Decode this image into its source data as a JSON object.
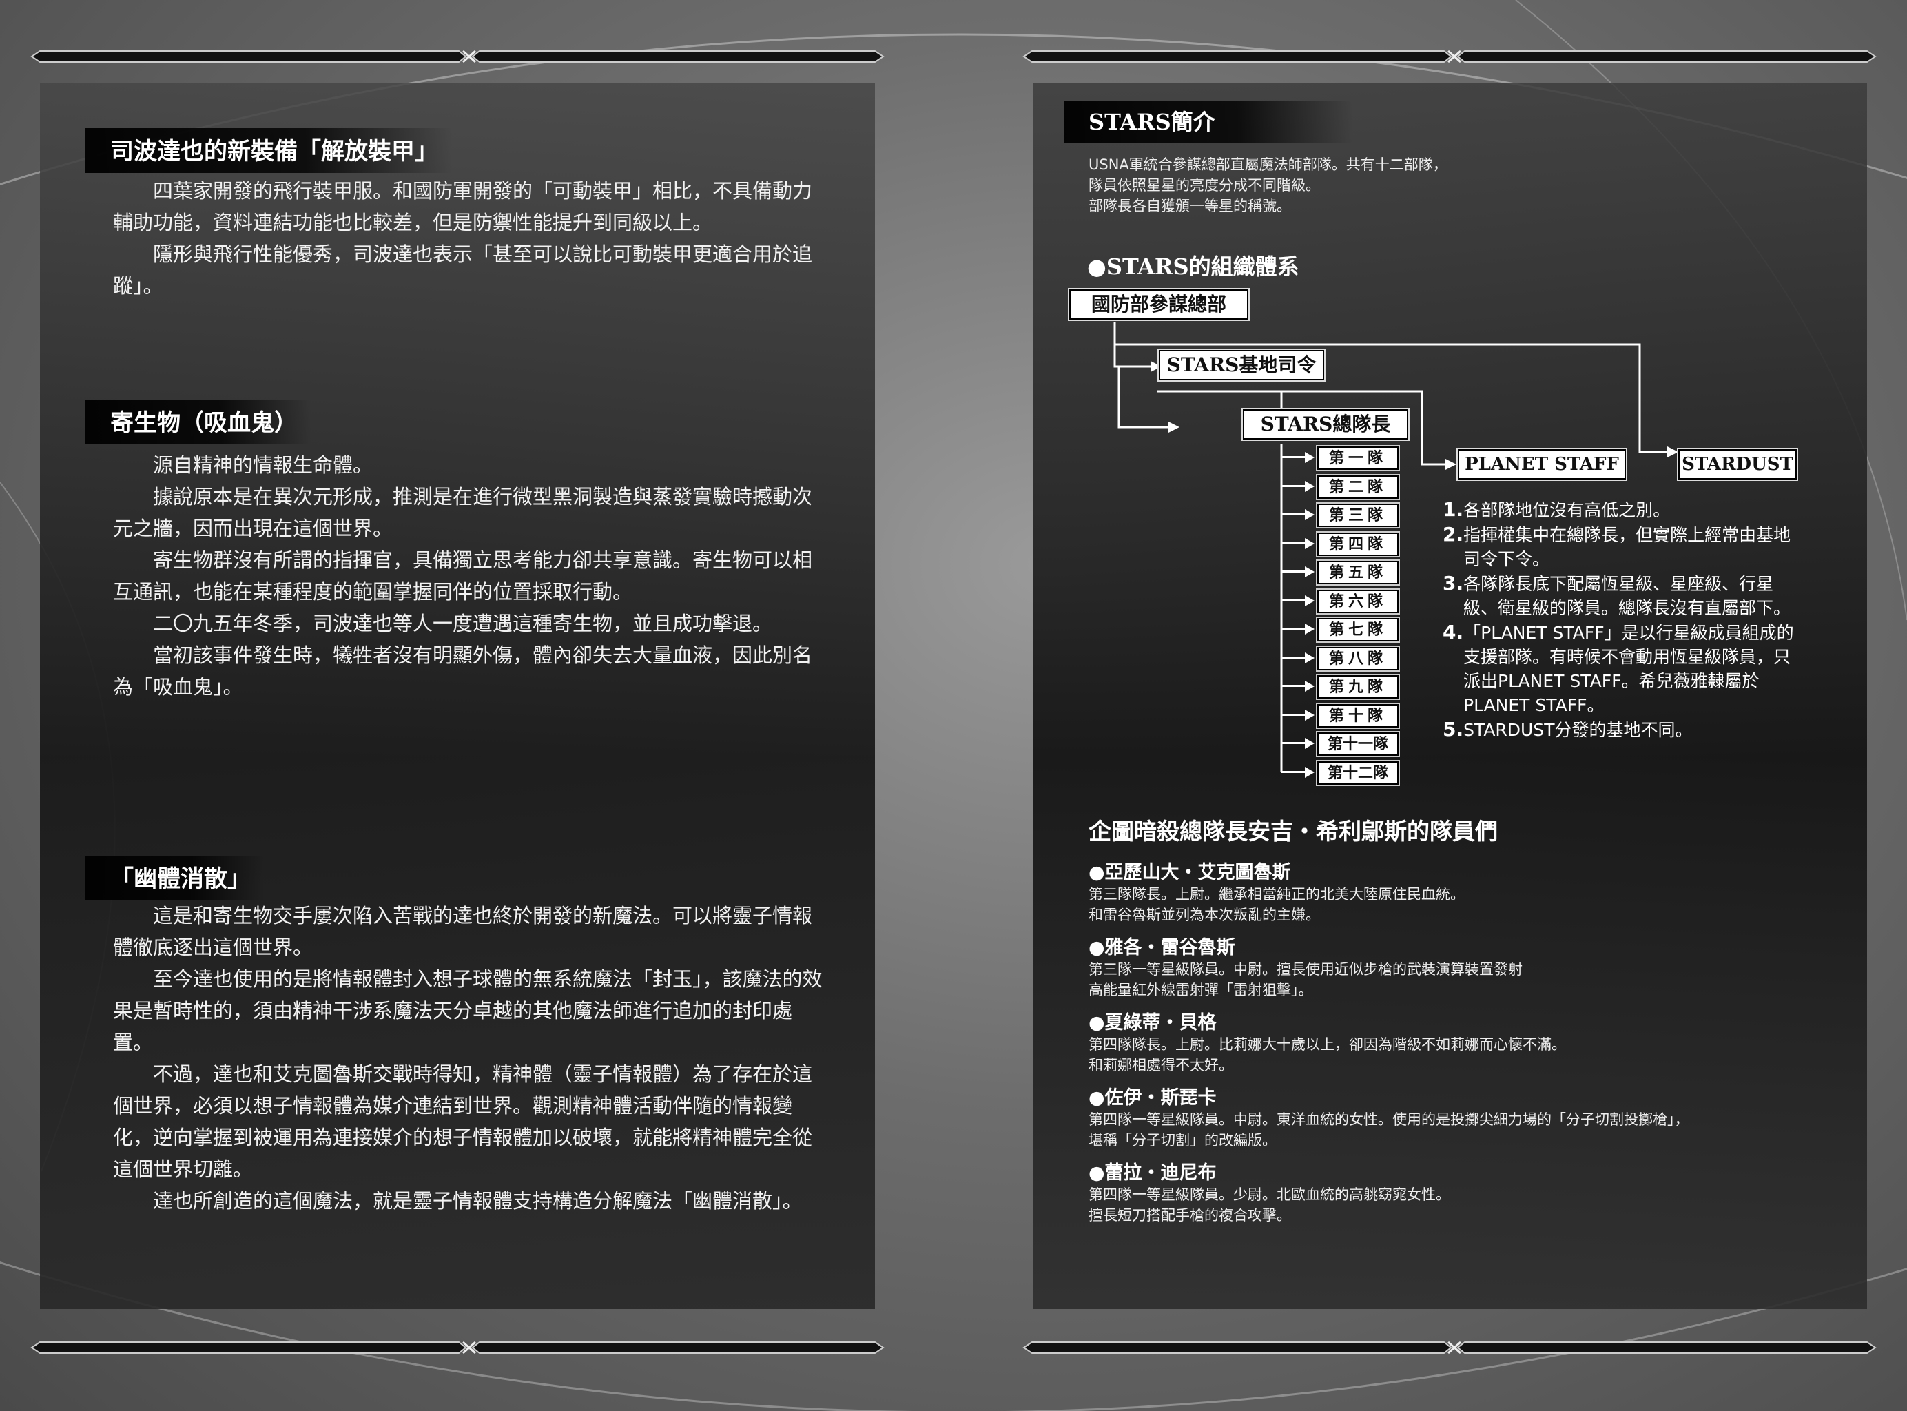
{
  "left": {
    "sections": [
      {
        "title": "司波達也的新裝備「解放裝甲」",
        "paragraphs": [
          "四葉家開發的飛行裝甲服。和國防軍開發的「可動裝甲」相比，不具備動力輔助功能，資料連結功能也比較差，但是防禦性能提升到同級以上。",
          "隱形與飛行性能優秀，司波達也表示「甚至可以說比可動裝甲更適合用於追蹤」。"
        ]
      },
      {
        "title": "寄生物（吸血鬼）",
        "paragraphs": [
          "源自精神的情報生命體。",
          "據說原本是在異次元形成，推測是在進行微型黑洞製造與蒸發實驗時撼動次元之牆，因而出現在這個世界。",
          "寄生物群沒有所謂的指揮官，具備獨立思考能力卻共享意識。寄生物可以相互通訊，也能在某種程度的範圍掌握同伴的位置採取行動。",
          "二〇九五年冬季，司波達也等人一度遭遇這種寄生物，並且成功擊退。",
          "當初該事件發生時，犧牲者沒有明顯外傷，體內卻失去大量血液，因此別名為「吸血鬼」。"
        ]
      },
      {
        "title": "「幽體消散」",
        "paragraphs": [
          "這是和寄生物交手屢次陷入苦戰的達也終於開發的新魔法。可以將靈子情報體徹底逐出這個世界。",
          "至今達也使用的是將情報體封入想子球體的無系統魔法「封玉」，該魔法的效果是暫時性的，須由精神干涉系魔法天分卓越的其他魔法師進行追加的封印處置。",
          "不過，達也和艾克圖魯斯交戰時得知，精神體（靈子情報體）為了存在於這個世界，必須以想子情報體為媒介連結到世界。觀測精神體活動伴隨的情報變化，逆向掌握到被運用為連接媒介的想子情報體加以破壞，就能將精神體完全從這個世界切離。",
          "達也所創造的這個魔法，就是靈子情報體支持構造分解魔法「幽體消散」。"
        ]
      }
    ]
  },
  "right": {
    "stars_intro": {
      "title": "STARS簡介",
      "lines": [
        "USNA軍統合參謀總部直屬魔法師部隊。共有十二部隊，",
        "隊員依照星星的亮度分成不同階級。",
        "部隊長各自獲頒一等星的稱號。"
      ]
    },
    "org_chart": {
      "title": "●STARS的組織體系",
      "hq": "國防部參謀總部",
      "base_commander": "STARS基地司令",
      "commander": "STARS總隊長",
      "planet_staff": "PLANET STAFF",
      "stardust": "STARDUST",
      "squads": [
        "第一隊",
        "第二隊",
        "第三隊",
        "第四隊",
        "第五隊",
        "第六隊",
        "第七隊",
        "第八隊",
        "第九隊",
        "第十隊",
        "第十一隊",
        "第十二隊"
      ]
    },
    "notes": [
      {
        "num": "1.",
        "text": "各部隊地位沒有高低之別。"
      },
      {
        "num": "2.",
        "text": "指揮權集中在總隊長，但實際上經常由基地司令下令。"
      },
      {
        "num": "3.",
        "text": "各隊隊長底下配屬恆星級、星座級、行星級、衛星級的隊員。總隊長沒有直屬部下。"
      },
      {
        "num": "4.",
        "text": "「PLANET STAFF」是以行星級成員組成的支援部隊。有時候不會動用恆星級隊員，只派出PLANET STAFF。希兒薇雅隸屬於PLANET STAFF。"
      },
      {
        "num": "5.",
        "text": "STARDUST分發的基地不同。"
      }
    ],
    "members_section": {
      "title": "企圖暗殺總隊長安吉・希利鄔斯的隊員們",
      "members": [
        {
          "name": "●亞歷山大・艾克圖魯斯",
          "desc": [
            "第三隊隊長。上尉。繼承相當純正的北美大陸原住民血統。",
            "和雷谷魯斯並列為本次叛亂的主嫌。"
          ]
        },
        {
          "name": "●雅各・雷谷魯斯",
          "desc": [
            "第三隊一等星級隊員。中尉。擅長使用近似步槍的武裝演算裝置發射",
            "高能量紅外線雷射彈「雷射狙擊」。"
          ]
        },
        {
          "name": "●夏綠蒂・貝格",
          "desc": [
            "第四隊隊長。上尉。比莉娜大十歲以上，卻因為階級不如莉娜而心懷不滿。",
            "和莉娜相處得不太好。"
          ]
        },
        {
          "name": "●佐伊・斯琵卡",
          "desc": [
            "第四隊一等星級隊員。中尉。東洋血統的女性。使用的是投擲尖細力場的「分子切割投擲槍」，",
            "堪稱「分子切割」的改編版。"
          ]
        },
        {
          "name": "●蕾拉・迪尼布",
          "desc": [
            "第四隊一等星級隊員。少尉。北歐血統的高䠷窈窕女性。",
            "擅長短刀搭配手槍的複合攻擊。"
          ]
        }
      ]
    }
  }
}
